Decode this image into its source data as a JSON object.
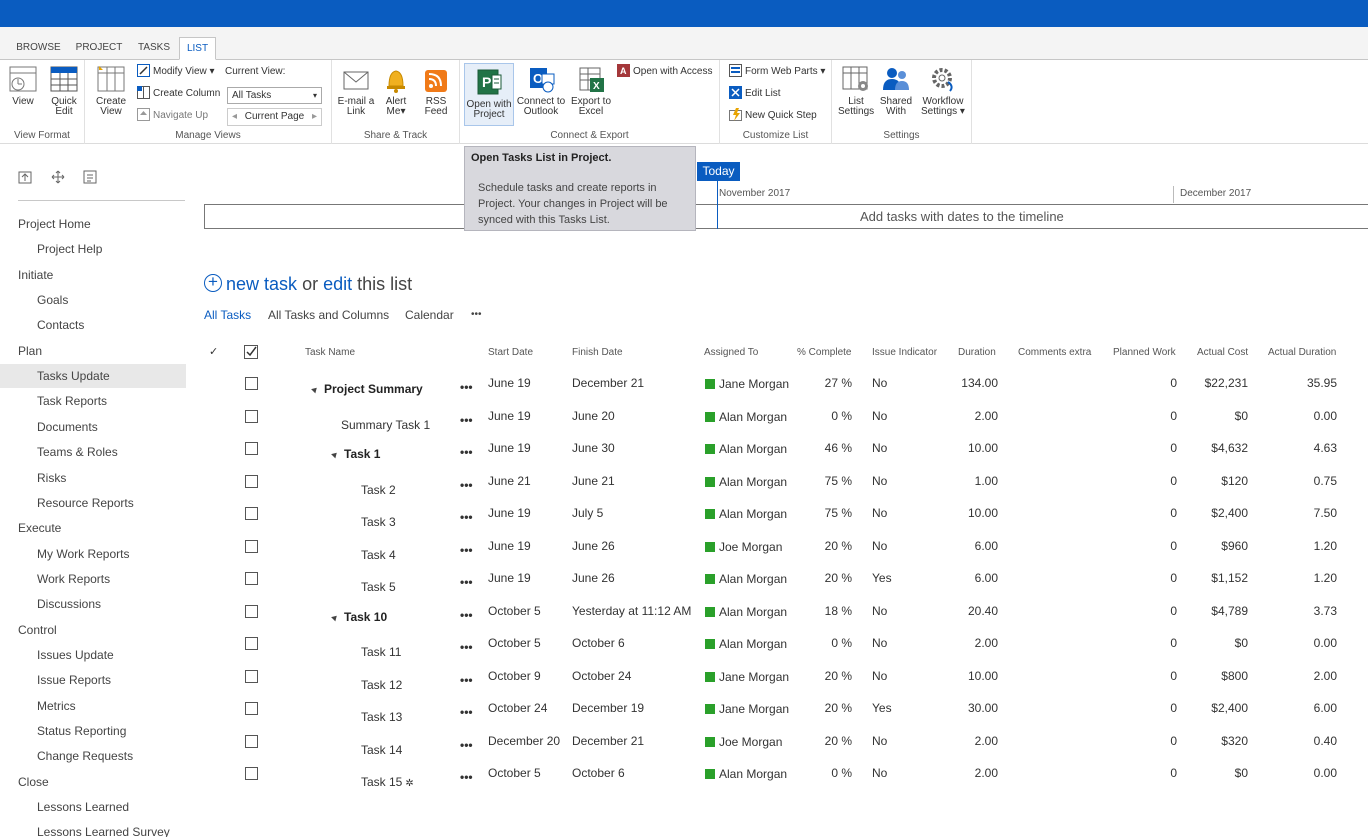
{
  "ribbon_tabs": [
    "BROWSE",
    "PROJECT",
    "TASKS",
    "LIST"
  ],
  "groups": {
    "view_format": {
      "label": "View Format",
      "view": "View",
      "quick_edit": [
        "Quick",
        "Edit"
      ]
    },
    "manage_views": {
      "label": "Manage Views",
      "create_view": [
        "Create",
        "View"
      ],
      "modify_view": "Modify View",
      "create_column": "Create Column",
      "navigate_up": "Navigate Up",
      "current_view_label": "Current View:",
      "current_view_value": "All Tasks",
      "current_page": "Current Page"
    },
    "share_track": {
      "label": "Share & Track",
      "email": [
        "E-mail a",
        "Link"
      ],
      "alert": [
        "Alert",
        "Me"
      ],
      "rss": [
        "RSS",
        "Feed"
      ]
    },
    "connect_export": {
      "label": "Connect & Export",
      "open_project": [
        "Open with",
        "Project"
      ],
      "connect_outlook": [
        "Connect to",
        "Outlook"
      ],
      "export_excel": [
        "Export to",
        "Excel"
      ],
      "open_access": "Open with Access"
    },
    "customize_list": {
      "label": "Customize List",
      "form_web_parts": "Form Web Parts",
      "edit_list": "Edit List",
      "new_quick_step": "New Quick Step"
    },
    "settings": {
      "label": "Settings",
      "list_settings": [
        "List",
        "Settings"
      ],
      "shared_with": [
        "Shared",
        "With"
      ],
      "workflow_settings": [
        "Workflow",
        "Settings"
      ]
    }
  },
  "tooltip": {
    "title": "Open Tasks List in Project.",
    "body": "Schedule tasks and create reports in Project. Your changes in Project will be synced with this Tasks List."
  },
  "timeline": {
    "today": "Today",
    "month1": "November 2017",
    "month2": "December 2017",
    "message": "Add tasks with dates to the timeline"
  },
  "nav": [
    {
      "label": "Project Home",
      "indent": 0
    },
    {
      "label": "Project Help",
      "indent": 1
    },
    {
      "label": "Initiate",
      "indent": 0
    },
    {
      "label": "Goals",
      "indent": 1
    },
    {
      "label": "Contacts",
      "indent": 1
    },
    {
      "label": "Plan",
      "indent": 0
    },
    {
      "label": "Tasks Update",
      "indent": 1,
      "selected": true
    },
    {
      "label": "Task Reports",
      "indent": 1
    },
    {
      "label": "Documents",
      "indent": 1
    },
    {
      "label": "Teams & Roles",
      "indent": 1
    },
    {
      "label": "Risks",
      "indent": 1
    },
    {
      "label": "Resource Reports",
      "indent": 1
    },
    {
      "label": "Execute",
      "indent": 0
    },
    {
      "label": "My Work Reports",
      "indent": 1
    },
    {
      "label": "Work Reports",
      "indent": 1
    },
    {
      "label": "Discussions",
      "indent": 1
    },
    {
      "label": "Control",
      "indent": 0
    },
    {
      "label": "Issues Update",
      "indent": 1
    },
    {
      "label": "Issue Reports",
      "indent": 1
    },
    {
      "label": "Metrics",
      "indent": 1
    },
    {
      "label": "Status Reporting",
      "indent": 1
    },
    {
      "label": "Change Requests",
      "indent": 1
    },
    {
      "label": "Close",
      "indent": 0
    },
    {
      "label": "Lessons Learned",
      "indent": 1
    },
    {
      "label": "Lessons Learned Survey",
      "indent": 1
    }
  ],
  "new_task": {
    "new": "new task",
    "or": "or",
    "edit": "edit",
    "rest": "this list"
  },
  "views": [
    "All Tasks",
    "All Tasks and Columns",
    "Calendar",
    "•••"
  ],
  "columns": [
    "Task Name",
    "Start Date",
    "Finish Date",
    "Assigned To",
    "% Complete",
    "Issue Indicator",
    "Duration",
    "Comments extra",
    "Planned Work",
    "Actual Cost",
    "Actual Duration"
  ],
  "rows": [
    {
      "name": "Project Summary",
      "level": 0,
      "summary": true,
      "start": "June 19",
      "finish": "December 21",
      "assigned": "Jane Morgan",
      "pct": "27 %",
      "issue": "No",
      "duration": "134.00",
      "planned": "0",
      "cost": "$22,231",
      "actual": "35.95"
    },
    {
      "name": "Summary Task 1",
      "level": 1,
      "summary": false,
      "start": "June 19",
      "finish": "June 20",
      "assigned": "Alan Morgan",
      "pct": "0 %",
      "issue": "No",
      "duration": "2.00",
      "planned": "0",
      "cost": "$0",
      "actual": "0.00"
    },
    {
      "name": "Task 1",
      "level": 1,
      "summary": true,
      "start": "June 19",
      "finish": "June 30",
      "assigned": "Alan Morgan",
      "pct": "46 %",
      "issue": "No",
      "duration": "10.00",
      "planned": "0",
      "cost": "$4,632",
      "actual": "4.63"
    },
    {
      "name": "Task 2",
      "level": 2,
      "summary": false,
      "start": "June 21",
      "finish": "June 21",
      "assigned": "Alan Morgan",
      "pct": "75 %",
      "issue": "No",
      "duration": "1.00",
      "planned": "0",
      "cost": "$120",
      "actual": "0.75"
    },
    {
      "name": "Task 3",
      "level": 2,
      "summary": false,
      "start": "June 19",
      "finish": "July 5",
      "assigned": "Alan Morgan",
      "pct": "75 %",
      "issue": "No",
      "duration": "10.00",
      "planned": "0",
      "cost": "$2,400",
      "actual": "7.50"
    },
    {
      "name": "Task 4",
      "level": 2,
      "summary": false,
      "start": "June 19",
      "finish": "June 26",
      "assigned": "Joe Morgan",
      "pct": "20 %",
      "issue": "No",
      "duration": "6.00",
      "planned": "0",
      "cost": "$960",
      "actual": "1.20"
    },
    {
      "name": "Task 5",
      "level": 2,
      "summary": false,
      "start": "June 19",
      "finish": "June 26",
      "assigned": "Alan Morgan",
      "pct": "20 %",
      "issue": "Yes",
      "duration": "6.00",
      "planned": "0",
      "cost": "$1,152",
      "actual": "1.20"
    },
    {
      "name": "Task 10",
      "level": 1,
      "summary": true,
      "start": "October 5",
      "finish": "Yesterday at 11:12 AM",
      "assigned": "Alan Morgan",
      "pct": "18 %",
      "issue": "No",
      "duration": "20.40",
      "planned": "0",
      "cost": "$4,789",
      "actual": "3.73"
    },
    {
      "name": "Task 11",
      "level": 2,
      "summary": false,
      "start": "October 5",
      "finish": "October 6",
      "assigned": "Alan Morgan",
      "pct": "0 %",
      "issue": "No",
      "duration": "2.00",
      "planned": "0",
      "cost": "$0",
      "actual": "0.00"
    },
    {
      "name": "Task 12",
      "level": 2,
      "summary": false,
      "start": "October 9",
      "finish": "October 24",
      "assigned": "Jane Morgan",
      "pct": "20 %",
      "issue": "No",
      "duration": "10.00",
      "planned": "0",
      "cost": "$800",
      "actual": "2.00"
    },
    {
      "name": "Task 13",
      "level": 2,
      "summary": false,
      "start": "October 24",
      "finish": "December 19",
      "assigned": "Jane Morgan",
      "pct": "20 %",
      "issue": "Yes",
      "duration": "30.00",
      "planned": "0",
      "cost": "$2,400",
      "actual": "6.00"
    },
    {
      "name": "Task 14",
      "level": 2,
      "summary": false,
      "start": "December 20",
      "finish": "December 21",
      "assigned": "Joe Morgan",
      "pct": "20 %",
      "issue": "No",
      "duration": "2.00",
      "planned": "0",
      "cost": "$320",
      "actual": "0.40"
    },
    {
      "name": "Task 15",
      "level": 2,
      "summary": false,
      "new_badge": "✲",
      "start": "October 5",
      "finish": "October 6",
      "assigned": "Alan Morgan",
      "pct": "0 %",
      "issue": "No",
      "duration": "2.00",
      "planned": "0",
      "cost": "$0",
      "actual": "0.00"
    }
  ],
  "colors": {
    "brand": "#0a5cc0",
    "status_green": "#2aa02a"
  }
}
